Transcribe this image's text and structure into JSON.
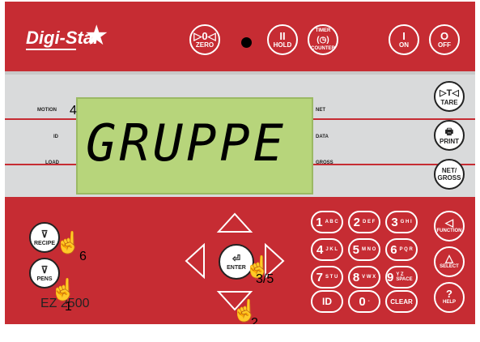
{
  "header": {
    "logo": "Digi-Star",
    "buttons": {
      "zero": {
        "icon": "▷0◁",
        "label": "ZERO"
      },
      "hold": {
        "icon": "II",
        "label": "HOLD"
      },
      "timer": {
        "top": "TIMER",
        "icon": "(◷)",
        "label": "COUNTER"
      },
      "on": {
        "icon": "I",
        "label": "ON"
      },
      "off": {
        "icon": "O",
        "label": "OFF"
      }
    }
  },
  "display": {
    "number": "4",
    "text": "GRUPPE",
    "left_labels": {
      "motion": "MOTION",
      "id": "ID",
      "load": "LOAD"
    },
    "right_labels": {
      "net": "NET",
      "data": "DATA",
      "gross": "GROSS"
    }
  },
  "side_buttons": {
    "tare": {
      "icon": "▷T◁",
      "label": "TARE"
    },
    "print": {
      "icon": "🖶",
      "label": "PRINT"
    },
    "netgross": {
      "line1": "NET/",
      "line2": "GROSS"
    }
  },
  "lower": {
    "recipe_label": "RECIPE",
    "pens_label": "PENS",
    "enter_label": "ENTER",
    "model": "EZ 2500",
    "keypad": [
      {
        "key": "1",
        "sub": "A B C"
      },
      {
        "key": "2",
        "sub": "D E F"
      },
      {
        "key": "3",
        "sub": "G H I"
      },
      {
        "key": "4",
        "sub": "J K L"
      },
      {
        "key": "5",
        "sub": "M N O"
      },
      {
        "key": "6",
        "sub": "P Q R"
      },
      {
        "key": "7",
        "sub": "S T U"
      },
      {
        "key": "8",
        "sub": "V W X"
      },
      {
        "key": "9",
        "sub": "Y Z SPACE"
      },
      {
        "key": "ID",
        "sub": ""
      },
      {
        "key": "0",
        "sub": "-"
      },
      {
        "key": "CLEAR",
        "sub": ""
      }
    ],
    "function_buttons": {
      "function": {
        "icon": "◁",
        "label": "FUNCTION"
      },
      "select": {
        "icon": "△",
        "label": "SELECT"
      },
      "help": {
        "icon": "?",
        "label": "HELP"
      }
    }
  },
  "step_markers": {
    "recipe": "6",
    "pens": "1",
    "enter": "3/5",
    "down": "2"
  }
}
